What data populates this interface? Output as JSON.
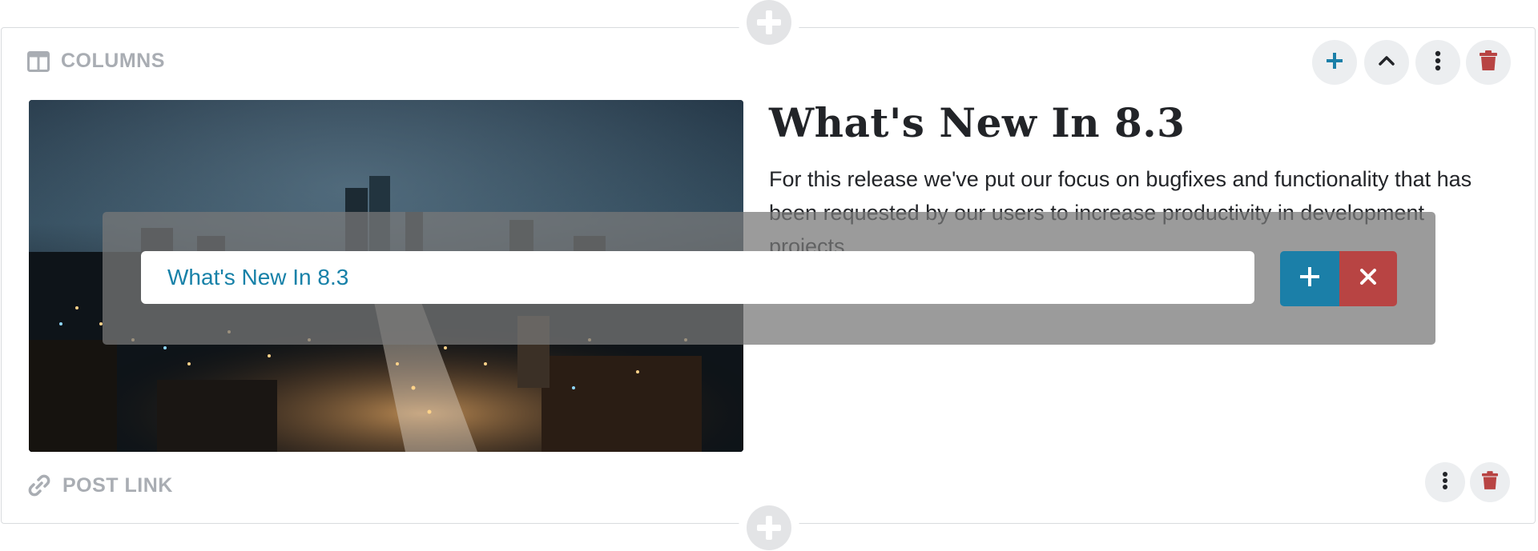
{
  "columns_block": {
    "label": "COLUMNS",
    "heading": "What's New In 8.3",
    "paragraph": "For this release we've put our focus on bugfixes and functionality that has been requested by our users to increase productivity in development projects.",
    "image_alt": "Night city skyline"
  },
  "inline_editor": {
    "input_value": "What's New In 8.3"
  },
  "postlink_block": {
    "label": "POST LINK"
  },
  "icons": {
    "columns": "columns-icon",
    "link": "link-icon",
    "add": "plus-icon",
    "collapse": "chevron-up-icon",
    "more": "vertical-dots-icon",
    "delete": "trash-icon",
    "confirm": "plus-icon",
    "cancel": "close-icon"
  },
  "colors": {
    "accent": "#1b7fa8",
    "danger": "#b84443",
    "muted_label": "#a9adb3"
  }
}
